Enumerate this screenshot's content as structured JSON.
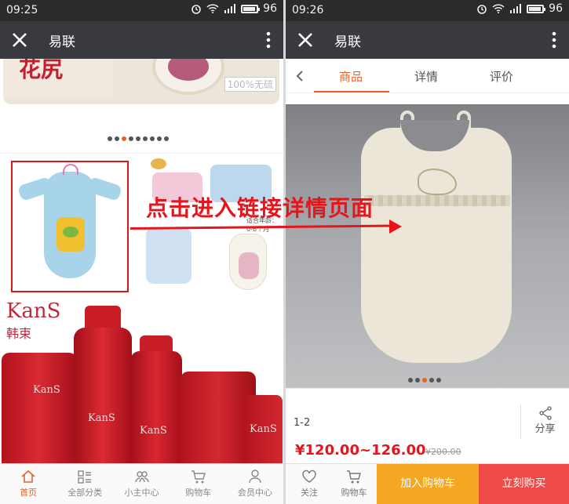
{
  "left_screen": {
    "status": {
      "time": "09:25",
      "battery": "96"
    },
    "titlebar": {
      "title": "易联"
    },
    "banner": {
      "pack_text": "花尻",
      "tag": "100%无硫"
    },
    "carousel": {
      "count": 9,
      "active_index": 2
    },
    "kans_logo": "KanS",
    "kans_logo_cn": "韩束",
    "kans_small_a": "KanS",
    "kans_small_b": "KanS",
    "kans_small_c": "KanS",
    "kans_small_d": "KanS",
    "pj_tag": "适合年龄：0-6个月",
    "tabs": [
      {
        "label": "首页",
        "icon": "home-icon",
        "active": true
      },
      {
        "label": "全部分类",
        "icon": "category-icon",
        "active": false
      },
      {
        "label": "小主中心",
        "icon": "users-icon",
        "active": false
      },
      {
        "label": "购物车",
        "icon": "cart-icon",
        "active": false
      },
      {
        "label": "会员中心",
        "icon": "user-icon",
        "active": false
      }
    ]
  },
  "callout": {
    "text": "点击进入链接详情页面"
  },
  "right_screen": {
    "status": {
      "time": "09:26",
      "battery": "96"
    },
    "titlebar": {
      "title": "易联"
    },
    "product_tabs": [
      {
        "label": "商品",
        "active": true
      },
      {
        "label": "详情",
        "active": false
      },
      {
        "label": "评价",
        "active": false
      }
    ],
    "carousel": {
      "count": 5,
      "active_index": 2
    },
    "product": {
      "variant": "1-2",
      "price": "¥120.00~126.00",
      "original_price": "¥200.00",
      "share_label": "分享"
    },
    "actions": {
      "follow_label": "关注",
      "cart_label": "购物车",
      "add_to_cart": "加入购物车",
      "buy_now": "立刻购买"
    }
  },
  "colors": {
    "accent": "#e8632b",
    "price_red": "#e8141b",
    "titlebar": "#393a3f",
    "statusbar": "#2b2b2b",
    "add_cart_bg": "#f5a623",
    "buy_bg": "#ee4a47",
    "highlight_border": "#d21b1b"
  }
}
